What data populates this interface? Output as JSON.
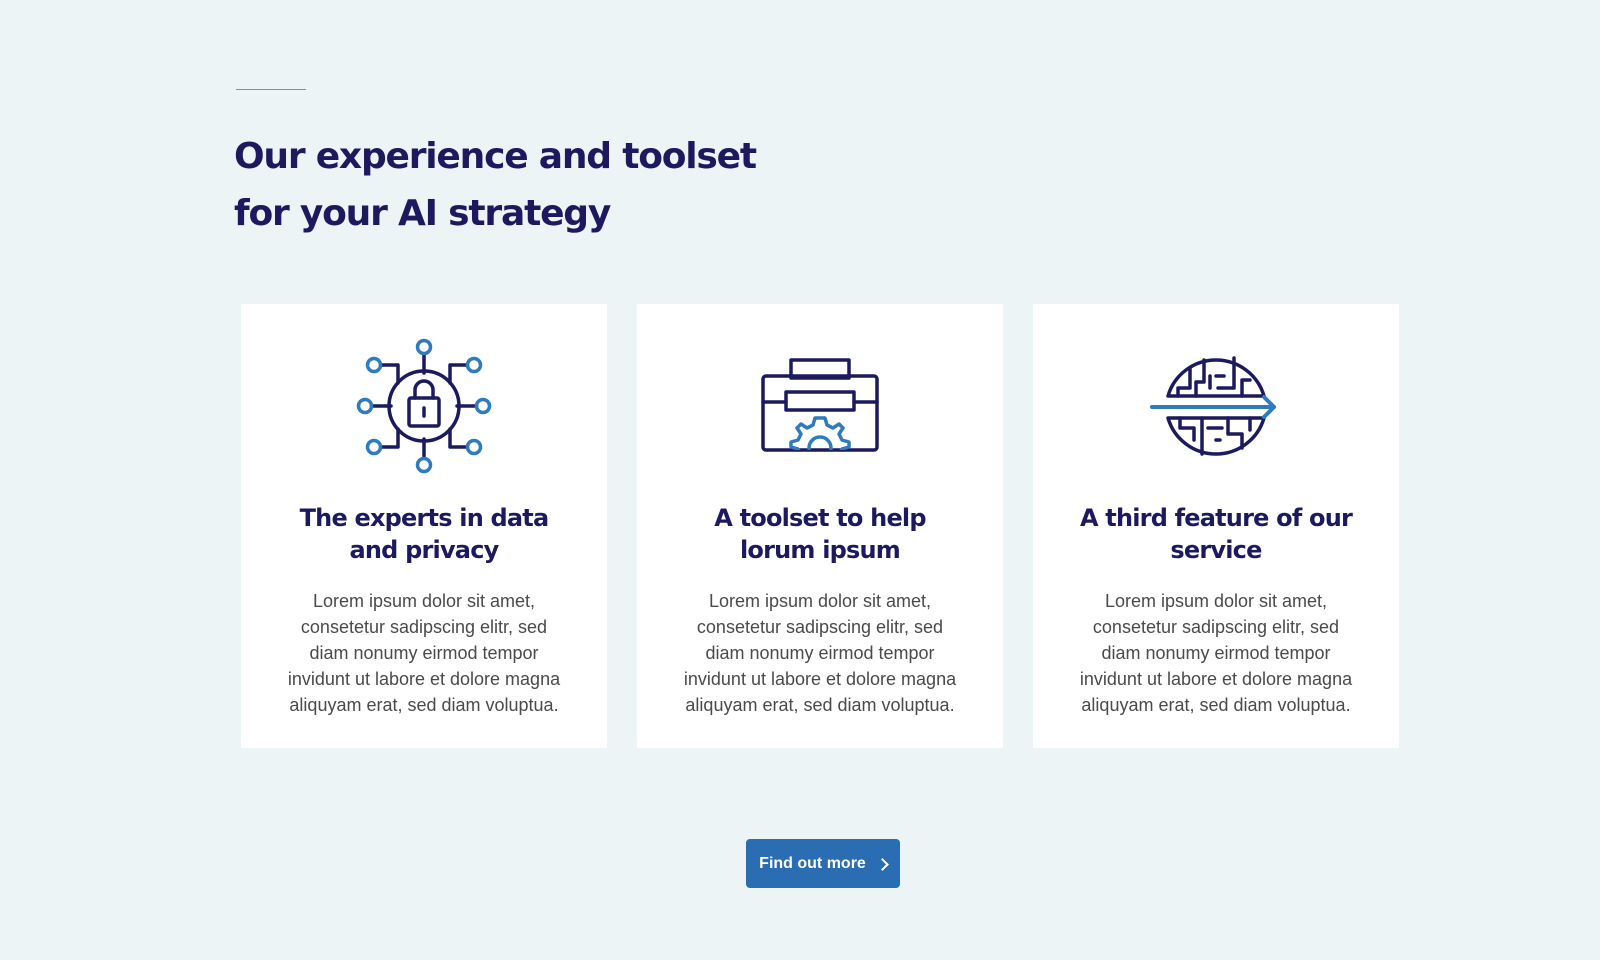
{
  "section": {
    "heading_line1": "Our experience and toolset",
    "heading_line2": "for your AI strategy"
  },
  "cards": [
    {
      "icon": "network-lock-icon",
      "title_line1": "The experts in data",
      "title_line2": "and privacy",
      "text_lines": [
        "Lorem ipsum dolor sit amet,",
        "consetetur sadipscing elitr, sed",
        "diam nonumy eirmod tempor",
        "invidunt ut labore et dolore magna",
        "aliquyam erat, sed diam voluptua."
      ]
    },
    {
      "icon": "toolbox-gear-icon",
      "title_line1": "A toolset to help",
      "title_line2": "lorum ipsum",
      "text_lines": [
        "Lorem ipsum dolor sit amet,",
        "consetetur sadipscing elitr, sed",
        "diam nonumy eirmod tempor",
        "invidunt ut labore et dolore magna",
        "aliquyam erat, sed diam voluptua."
      ]
    },
    {
      "icon": "circuit-globe-arrow-icon",
      "title_line1": "A third feature of our",
      "title_line2": "service",
      "text_lines": [
        "Lorem ipsum dolor sit amet,",
        "consetetur sadipscing elitr, sed",
        "diam nonumy eirmod tempor",
        "invidunt ut labore et dolore magna",
        "aliquyam erat, sed diam voluptua."
      ]
    }
  ],
  "cta": {
    "label": "Find out more",
    "icon": "chevron-right-icon"
  },
  "colors": {
    "background": "#edf4f6",
    "heading": "#1c1a5e",
    "accent": "#2a6db2",
    "icon_dark": "#1c1a5e",
    "icon_light": "#2f7bbd",
    "body_text": "#4a4a4a"
  }
}
